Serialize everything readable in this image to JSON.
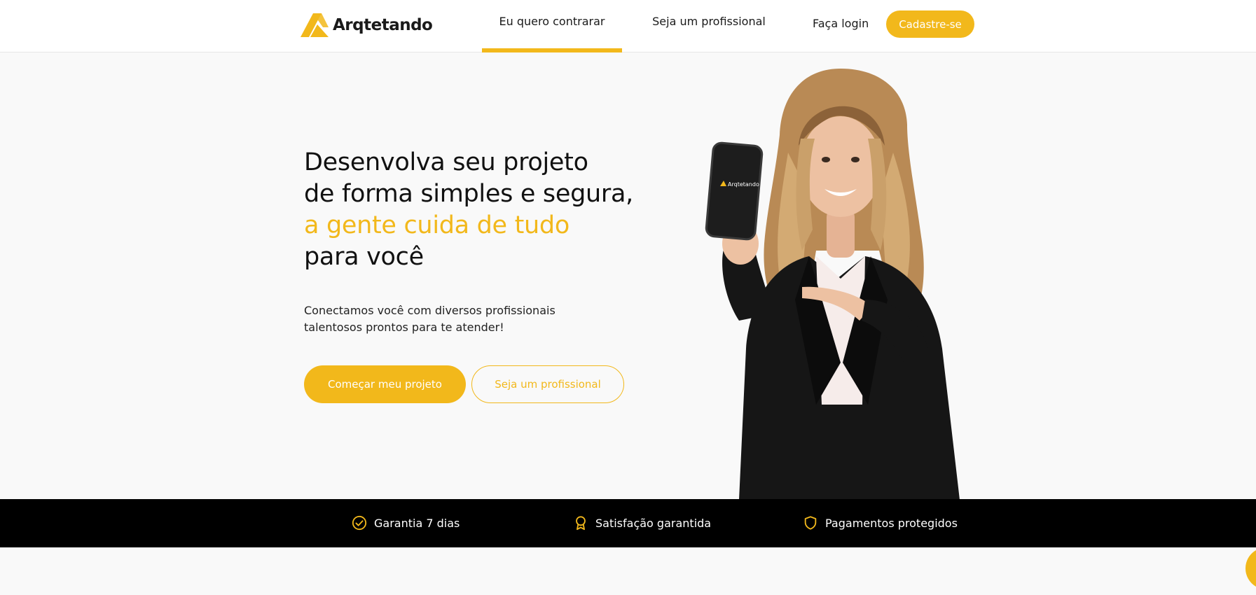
{
  "header": {
    "logo_text": "Arqtetando",
    "tabs": [
      {
        "label": "Eu quero contrarar",
        "active": true
      },
      {
        "label": "Seja um profissional",
        "active": false
      }
    ],
    "login_label": "Faça login",
    "signup_label": "Cadastre-se"
  },
  "hero": {
    "heading_line1": "Desenvolva seu projeto",
    "heading_line2": "de forma simples e segura,",
    "heading_accent": "a gente cuida de tudo",
    "heading_line4": "para você",
    "subtitle": "Conectamos você com diversos profissionais talentosos prontos para te atender!",
    "primary_button": "Começar meu projeto",
    "secondary_button": "Seja um profissional",
    "phone_logo_text": "Arqtetando"
  },
  "features": [
    {
      "label": "Garantia 7 dias",
      "icon": "check-circle-icon"
    },
    {
      "label": "Satisfação garantida",
      "icon": "award-ribbon-icon"
    },
    {
      "label": "Pagamentos protegidos",
      "icon": "shield-icon"
    }
  ],
  "colors": {
    "accent": "#f2b81b",
    "dark": "#000000",
    "background": "#f9f9f9"
  }
}
